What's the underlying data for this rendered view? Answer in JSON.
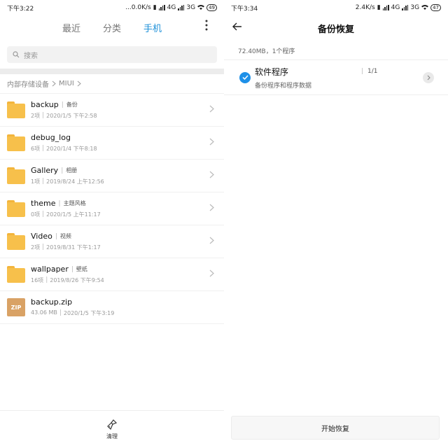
{
  "left": {
    "status": {
      "time": "下午3:22",
      "speed": "...0.0K/s",
      "net1": "4G",
      "net2": "3G",
      "battery": "49"
    },
    "tabs": [
      {
        "label": "最近"
      },
      {
        "label": "分类"
      },
      {
        "label": "手机"
      }
    ],
    "active_tab": "手机",
    "search_placeholder": "搜索",
    "breadcrumb": [
      "内部存储设备",
      "MIUI"
    ],
    "files": [
      {
        "name": "backup",
        "alias": "备份",
        "count": "2项",
        "date": "2020/1/5 下午2:58",
        "type": "folder"
      },
      {
        "name": "debug_log",
        "alias": "",
        "count": "6项",
        "date": "2020/1/4 下午8:18",
        "type": "folder"
      },
      {
        "name": "Gallery",
        "alias": "相册",
        "count": "1项",
        "date": "2019/8/24 上午12:56",
        "type": "folder"
      },
      {
        "name": "theme",
        "alias": "主题风格",
        "count": "0项",
        "date": "2020/1/5 上午11:17",
        "type": "folder"
      },
      {
        "name": "Video",
        "alias": "视频",
        "count": "2项",
        "date": "2019/8/31 下午1:17",
        "type": "folder"
      },
      {
        "name": "wallpaper",
        "alias": "壁纸",
        "count": "16项",
        "date": "2019/8/26 下午9:54",
        "type": "folder"
      },
      {
        "name": "backup.zip",
        "alias": "",
        "count": "43.06 MB",
        "date": "2020/1/5 下午3:19",
        "type": "zip",
        "icon_text": "ZIP"
      }
    ],
    "bottom_label": "清理"
  },
  "right": {
    "status": {
      "time": "下午3:34",
      "speed": "2.4K/s",
      "net1": "4G",
      "net2": "3G",
      "battery": "47"
    },
    "title": "备份恢复",
    "summary": "72.40MB，1个程序",
    "item": {
      "title": "软件程序",
      "subtitle": "备份程序和程序数据",
      "count": "1/1"
    },
    "start_button": "开始恢复"
  },
  "colors": {
    "accent": "#1e90d8",
    "folder": "#f7c04b",
    "zip": "#d9a265"
  }
}
